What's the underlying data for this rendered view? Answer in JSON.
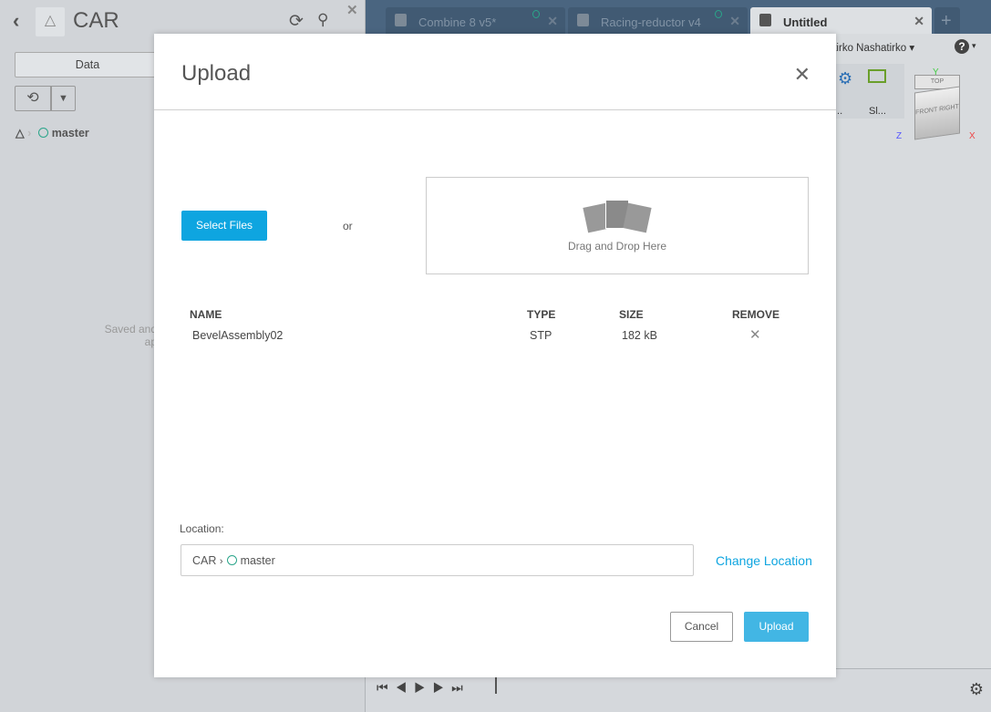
{
  "project": {
    "title": "CAR",
    "data_tab": "Data",
    "branch": "master",
    "saved_text_1": "Saved and",
    "saved_text_2": "ap"
  },
  "tabs": [
    {
      "label": "Combine 8 v5*"
    },
    {
      "label": "Racing-reductor v4"
    },
    {
      "label": "Untitled",
      "active": true
    }
  ],
  "user": {
    "name": "Nashatirko Nashatirko"
  },
  "toolbar": {
    "tool1": "...",
    "tool2": "Sl..."
  },
  "viewcube": {
    "top": "TOP",
    "front": "FRONT",
    "right": "RIGHT",
    "x": "X",
    "y": "Y",
    "z": "Z"
  },
  "modal": {
    "title": "Upload",
    "select_files": "Select Files",
    "or": "or",
    "drop_text": "Drag and Drop Here",
    "columns": [
      "NAME",
      "TYPE",
      "SIZE",
      "REMOVE"
    ],
    "files": [
      {
        "name": "BevelAssembly02",
        "type": "STP",
        "size": "182 kB"
      }
    ],
    "location_label": "Location:",
    "location_project": "CAR",
    "location_branch": "master",
    "change_location": "Change Location",
    "cancel": "Cancel",
    "upload": "Upload"
  },
  "colors": {
    "accent": "#0ea5e0",
    "branch": "#2aa58a",
    "topbar": "#4a6580"
  }
}
